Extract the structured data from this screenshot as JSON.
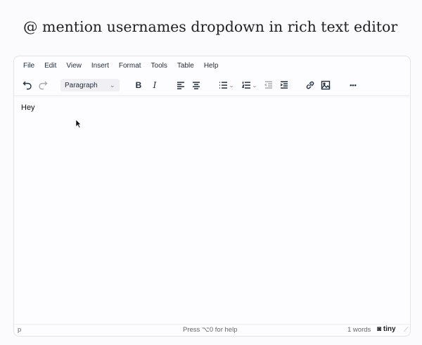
{
  "page_title": "@ mention usernames dropdown in rich text editor",
  "menu": [
    "File",
    "Edit",
    "View",
    "Insert",
    "Format",
    "Tools",
    "Table",
    "Help"
  ],
  "toolbar": {
    "block_format": "Paragraph",
    "bold": "B",
    "italic": "I",
    "more": "•••"
  },
  "content": {
    "text": "Hey"
  },
  "status": {
    "path": "p",
    "help": "Press ⌥0 for help",
    "word_count": "1 words",
    "brand": "tiny"
  }
}
